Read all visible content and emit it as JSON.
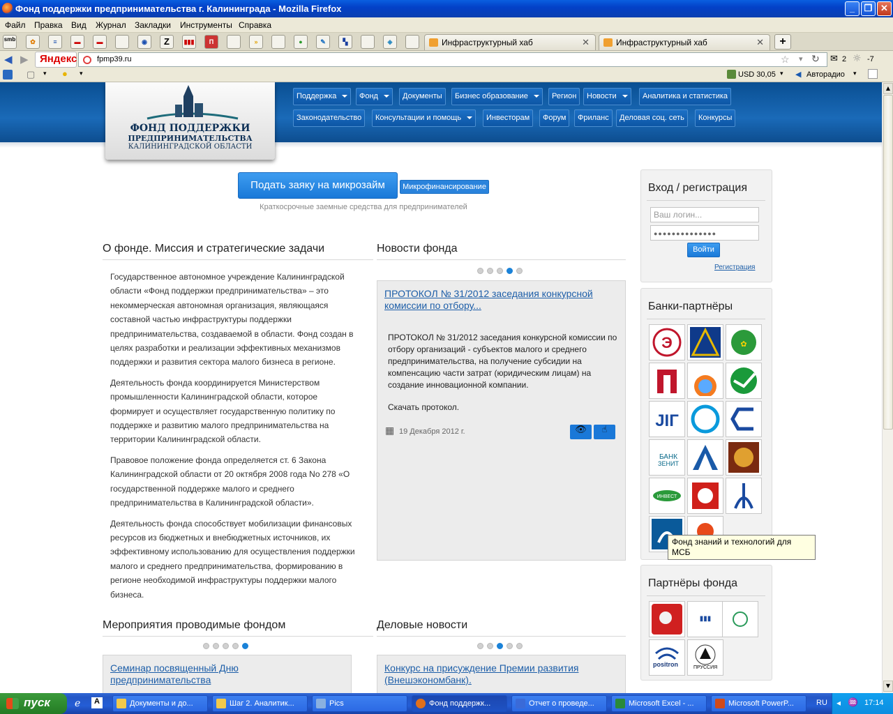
{
  "window": {
    "title": "Фонд поддержки предпринимательства г. Калининграда - Mozilla Firefox"
  },
  "menubar": [
    "Файл",
    "Правка",
    "Вид",
    "Журнал",
    "Закладки",
    "Инструменты",
    "Справка"
  ],
  "toolbar_icons": [
    "smb",
    "Z"
  ],
  "tabs": [
    {
      "label": "Инфраструктурный хаб"
    },
    {
      "label": "Инфраструктурный хаб"
    }
  ],
  "navbar": {
    "url": "fpmp39.ru",
    "search_brand": "Яндекс",
    "mail_count": "2",
    "weather": "-7"
  },
  "bookmarks": {
    "currency": "USD 30,05",
    "radio": "Авторадио"
  },
  "site": {
    "logo": {
      "line1": "ФОНД ПОДДЕРЖКИ",
      "line2": "ПРЕДПРИНИМАТЕЛЬСТВА",
      "line3": "КАЛИНИНГРАДСКОЙ ОБЛАСТИ"
    },
    "nav_row1": [
      {
        "label": "Поддержка",
        "dropdown": true
      },
      {
        "label": "Фонд",
        "dropdown": true
      },
      {
        "label": "Документы",
        "dropdown": false
      },
      {
        "label": "Бизнес образование",
        "dropdown": true
      },
      {
        "label": "Регион",
        "dropdown": false
      },
      {
        "label": "Новости",
        "dropdown": true
      },
      {
        "label": "Аналитика и статистика",
        "dropdown": false
      }
    ],
    "nav_row2": [
      {
        "label": "Законодательство",
        "dropdown": false
      },
      {
        "label": "Консультации и помощь",
        "dropdown": true
      },
      {
        "label": "Инвесторам",
        "dropdown": false
      },
      {
        "label": "Форум",
        "dropdown": false
      },
      {
        "label": "Фриланс",
        "dropdown": false
      },
      {
        "label": "Деловая соц. сеть",
        "dropdown": false
      },
      {
        "label": "Конкурсы",
        "dropdown": false
      }
    ],
    "cta": {
      "button": "Подать заяку на микрозайм",
      "tag": "Микрофинансирование",
      "subtitle": "Краткосрочные заемные средства для предпринимателей"
    },
    "about": {
      "title": "О фонде. Миссия и стратегические задачи",
      "paragraphs": [
        "Государственное автономное учреждение Калининградской области «Фонд поддержки предпринимательства» – это некоммерческая автономная организация, являющаяся составной частью инфраструктуры поддержки предпринимательства, создаваемой в области. Фонд создан в целях разработки и реализации эффективных механизмов поддержки и развития сектора малого бизнеса в регионе.",
        "Деятельность фонда координируется Министерством промышленности Калининградской области, которое формирует и осуществляет государственную политику по поддержке и развитию малого предпринимательства на территории Калининградской области.",
        "Правовое положение фонда определяется ст. 6 Закона Калининградской области от 20 октября 2008 года No 278 «О государственной поддержке малого и среднего предпринимательства в Калининградской области».",
        "Деятельность фонда способствует мобилизации финансовых ресурсов из бюджетных и внебюджетных источников, их эффективному использованию для осуществления поддержки малого и среднего предпринимательства, формированию в регионе необходимой инфраструктуры поддержки малого бизнеса."
      ]
    },
    "news": {
      "title": "Новости фонда",
      "active_dot": 4,
      "item_title": "ПРОТОКОЛ № 31/2012 заседания конкурсной комиссии по отбору...",
      "item_body": "ПРОТОКОЛ № 31/2012 заседания конкурсной комиссии по отбору организаций - субъектов малого и среднего предпринимательства, на получение субсидии на компенсацию части затрат (юридическим лицам) на создание инновационной компании.",
      "item_link": "Скачать протокол.",
      "date": "19 Декабря 2012 г."
    },
    "events": {
      "title": "Мероприятия проводимые фондом",
      "active_dot": 5,
      "item_title": "Семинар посвященный Дню предпринимательства"
    },
    "business_news": {
      "title": "Деловые новости",
      "active_dot": 3,
      "item_title": "Конкурс на присуждение Премии развития (Внешэкономбанк)."
    },
    "login": {
      "title": "Вход / регистрация",
      "login_placeholder": "Ваш логин...",
      "password_mask": "●●●●●●●●●●●●●●",
      "submit": "Войти",
      "register": "Регистрация"
    },
    "banks": {
      "title": "Банки-партнёры"
    },
    "partners": {
      "title": "Партнёры фонда",
      "tooltip": "Фонд знаний и технологий для МСБ",
      "labels": [
        "positron",
        "ПРУССИЯ"
      ]
    }
  },
  "taskbar": {
    "start": "пуск",
    "items": [
      {
        "label": "Документы и до..."
      },
      {
        "label": "Шаг 2. Аналитик..."
      },
      {
        "label": "Pics"
      },
      {
        "label": "Фонд поддержк..."
      },
      {
        "label": "Отчет о проведе..."
      },
      {
        "label": "Microsoft Excel - ..."
      },
      {
        "label": "Microsoft PowerP..."
      }
    ],
    "lang": "RU",
    "clock": "17:14"
  }
}
